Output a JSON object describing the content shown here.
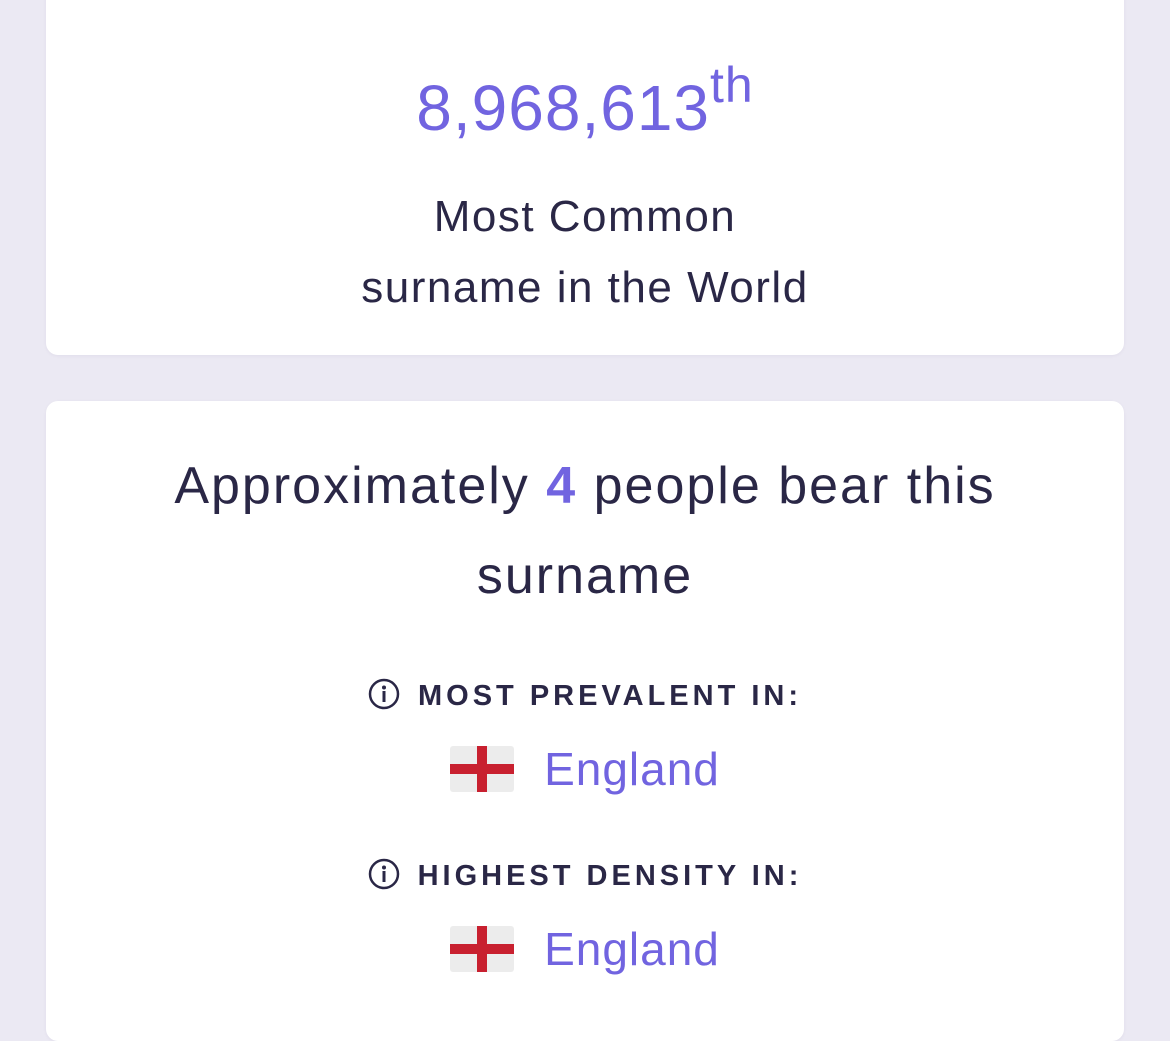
{
  "rank_card": {
    "rank_number": "8,968,613",
    "rank_suffix": "th",
    "caption_line1": "Most Common",
    "caption_line2": "surname in the World"
  },
  "people_card": {
    "text_before": "Approximately ",
    "count": "4",
    "text_after": " people bear this surname",
    "most_prevalent": {
      "heading": "MOST PREVALENT IN:",
      "icon": "info-icon",
      "flag": "england-flag",
      "country": "England"
    },
    "highest_density": {
      "heading": "HIGHEST DENSITY IN:",
      "icon": "info-icon",
      "flag": "england-flag",
      "country": "England"
    }
  },
  "colors": {
    "accent": "#7164e0",
    "text": "#2a2746",
    "background": "#ebe9f3",
    "card": "#ffffff",
    "flag_red": "#c8202f"
  }
}
